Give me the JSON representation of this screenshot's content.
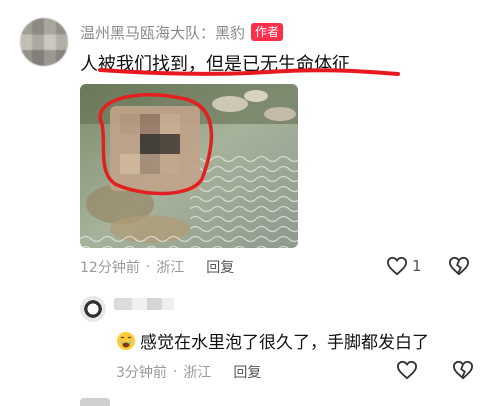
{
  "comment": {
    "author": "温州黑马瓯海大队：黑豹",
    "author_badge": "作者",
    "text": "人被我们找到，但是已无生命体征",
    "time": "12分钟前",
    "location": "浙江",
    "reply_label": "回复",
    "like_count": "1"
  },
  "reply": {
    "text": "感觉在水里泡了很久了，手脚都发白了",
    "time": "3分钟前",
    "location": "浙江",
    "reply_label": "回复"
  },
  "colors": {
    "badge": "#ff2e4d",
    "annotation_red": "#e8191e",
    "meta_gray": "#9a9a9a"
  },
  "icons": [
    "heart-icon",
    "dislike-heart-icon",
    "crying-emoji-icon"
  ]
}
